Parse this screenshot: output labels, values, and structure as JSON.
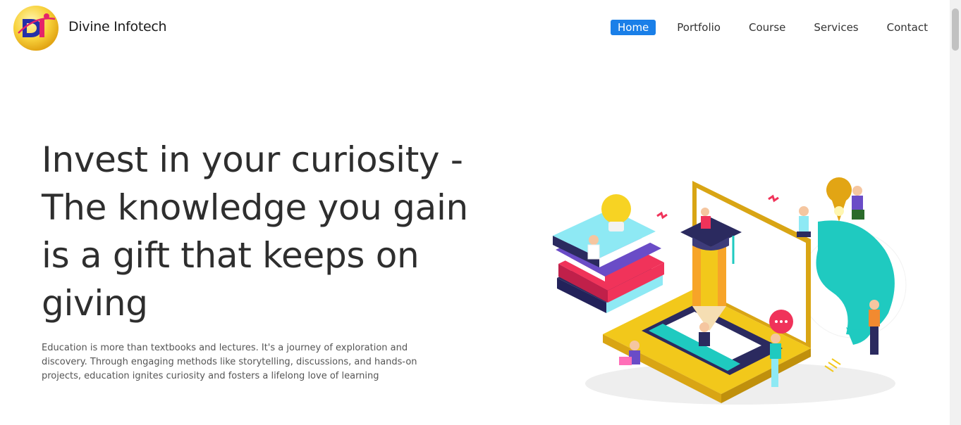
{
  "brand": {
    "name": "Divine Infotech",
    "logo_icon": "di-logo-icon"
  },
  "nav": {
    "items": [
      {
        "label": "Home",
        "active": true
      },
      {
        "label": "Portfolio",
        "active": false
      },
      {
        "label": "Course",
        "active": false
      },
      {
        "label": "Services",
        "active": false
      },
      {
        "label": "Contact",
        "active": false
      }
    ]
  },
  "hero": {
    "title_lines": [
      "Invest in your curiosity -",
      "The knowledge you gain",
      "is a gift that keeps on",
      "giving"
    ],
    "description": "Education is more than textbooks and lectures. It's a journey of exploration and discovery. Through engaging methods like storytelling, discussions, and hands-on projects, education ignites curiosity and fosters a lifelong love of learning",
    "illustration": "education-isometric-illustration"
  },
  "colors": {
    "accent": "#1a7fe8",
    "yellow": "#f2c81b",
    "teal": "#1fcac0",
    "navy": "#2b2a5f",
    "pink": "#f0335a",
    "purple": "#6a4cc7"
  }
}
